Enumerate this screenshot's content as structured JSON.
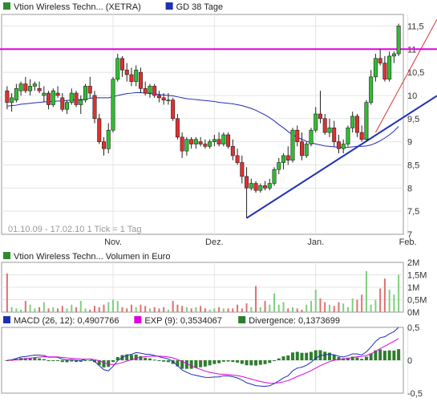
{
  "chart_data": [
    {
      "type": "candlestick",
      "legend": [
        {
          "label": "Vtion Wireless Techn... (XETRA)",
          "color": "#2e8b2e"
        },
        {
          "label": "GD 38 Tage",
          "color": "#1f2fb5"
        }
      ],
      "y_ticks": [
        "11,5",
        "11",
        "10,5",
        "10",
        "9,5",
        "9",
        "8,5",
        "8",
        "7,5",
        "7"
      ],
      "ylim": [
        7,
        11.75
      ],
      "x_ticks": [
        "Nov.",
        "Dez.",
        "Jan.",
        "Feb."
      ],
      "info_text": "01.10.09 - 17.02.10   1 Tick = 1 Tag",
      "horizontal_line": {
        "value": 11,
        "color": "#e000e0"
      },
      "candles": [
        [
          10.1,
          10.2,
          9.7,
          9.85
        ],
        [
          9.85,
          10.05,
          9.65,
          9.95
        ],
        [
          9.9,
          10.25,
          9.85,
          10.15
        ],
        [
          10.1,
          10.3,
          10.0,
          10.25
        ],
        [
          10.25,
          10.4,
          10.05,
          10.1
        ],
        [
          10.1,
          10.35,
          10.0,
          10.2
        ],
        [
          10.2,
          10.3,
          10.1,
          10.25
        ],
        [
          10.15,
          10.3,
          10.05,
          10.1
        ],
        [
          10.0,
          10.2,
          9.85,
          10.05
        ],
        [
          10.05,
          10.1,
          9.7,
          9.8
        ],
        [
          9.8,
          10.15,
          9.75,
          10.1
        ],
        [
          10.05,
          10.2,
          9.95,
          10.0
        ],
        [
          9.95,
          10.05,
          9.65,
          9.7
        ],
        [
          9.7,
          9.9,
          9.6,
          9.85
        ],
        [
          9.85,
          10.15,
          9.8,
          10.05
        ],
        [
          10.05,
          10.1,
          9.75,
          9.8
        ],
        [
          9.8,
          10.0,
          9.6,
          9.9
        ],
        [
          9.9,
          10.25,
          9.85,
          10.2
        ],
        [
          10.2,
          10.4,
          9.95,
          10.05
        ],
        [
          10.0,
          10.1,
          9.4,
          9.5
        ],
        [
          9.5,
          9.6,
          8.95,
          9.0
        ],
        [
          9.0,
          9.1,
          8.7,
          8.85
        ],
        [
          8.85,
          9.4,
          8.75,
          9.25
        ],
        [
          9.25,
          10.4,
          9.2,
          10.35
        ],
        [
          10.35,
          10.9,
          10.3,
          10.8
        ],
        [
          10.8,
          10.85,
          10.4,
          10.55
        ],
        [
          10.55,
          10.7,
          10.3,
          10.45
        ],
        [
          10.45,
          10.6,
          10.2,
          10.3
        ],
        [
          10.3,
          10.65,
          10.2,
          10.55
        ],
        [
          10.5,
          10.6,
          10.05,
          10.15
        ],
        [
          10.15,
          10.3,
          10.0,
          10.05
        ],
        [
          10.05,
          10.25,
          9.95,
          10.2
        ],
        [
          10.2,
          10.25,
          9.95,
          10.0
        ],
        [
          10.0,
          10.1,
          9.85,
          9.95
        ],
        [
          9.95,
          10.05,
          9.8,
          9.9
        ],
        [
          9.9,
          10.05,
          9.8,
          9.9
        ],
        [
          9.9,
          9.95,
          9.45,
          9.5
        ],
        [
          9.5,
          9.6,
          9.05,
          9.1
        ],
        [
          9.1,
          9.2,
          8.65,
          8.8
        ],
        [
          8.8,
          9.1,
          8.7,
          9.05
        ],
        [
          9.05,
          9.1,
          8.85,
          8.95
        ],
        [
          8.95,
          9.1,
          8.85,
          9.05
        ],
        [
          9.0,
          9.1,
          8.9,
          8.95
        ],
        [
          8.95,
          9.05,
          8.85,
          8.9
        ],
        [
          8.9,
          9.05,
          8.85,
          9.0
        ],
        [
          9.0,
          9.15,
          8.9,
          9.05
        ],
        [
          9.05,
          9.2,
          8.9,
          8.95
        ],
        [
          8.95,
          9.2,
          8.9,
          9.15
        ],
        [
          9.15,
          9.2,
          8.85,
          8.9
        ],
        [
          8.9,
          9.05,
          8.6,
          8.7
        ],
        [
          8.7,
          8.85,
          8.5,
          8.55
        ],
        [
          8.55,
          8.7,
          8.1,
          8.25
        ],
        [
          8.25,
          8.45,
          7.35,
          8.0
        ],
        [
          8.0,
          8.2,
          7.95,
          8.1
        ],
        [
          8.1,
          8.15,
          7.9,
          7.95
        ],
        [
          7.95,
          8.1,
          7.9,
          8.05
        ],
        [
          8.05,
          8.15,
          7.95,
          8.0
        ],
        [
          8.0,
          8.2,
          7.95,
          8.1
        ],
        [
          8.1,
          8.45,
          8.05,
          8.4
        ],
        [
          8.4,
          8.65,
          8.3,
          8.55
        ],
        [
          8.55,
          8.75,
          8.4,
          8.7
        ],
        [
          8.7,
          8.9,
          8.5,
          8.6
        ],
        [
          8.6,
          9.3,
          8.55,
          9.25
        ],
        [
          9.25,
          9.35,
          8.9,
          9.0
        ],
        [
          9.0,
          9.2,
          8.6,
          8.7
        ],
        [
          8.7,
          9.0,
          8.65,
          8.95
        ],
        [
          8.95,
          9.3,
          8.9,
          9.25
        ],
        [
          9.25,
          9.75,
          9.2,
          9.6
        ],
        [
          9.6,
          10.1,
          9.4,
          9.5
        ],
        [
          9.5,
          9.6,
          9.15,
          9.2
        ],
        [
          9.2,
          9.5,
          9.1,
          9.3
        ],
        [
          9.3,
          9.45,
          8.9,
          9.0
        ],
        [
          9.0,
          9.15,
          8.75,
          8.85
        ],
        [
          8.85,
          9.05,
          8.75,
          8.95
        ],
        [
          8.95,
          9.35,
          8.9,
          9.3
        ],
        [
          9.3,
          9.65,
          9.2,
          9.55
        ],
        [
          9.55,
          9.6,
          9.1,
          9.2
        ],
        [
          9.2,
          9.35,
          9.0,
          9.05
        ],
        [
          9.05,
          9.9,
          9.0,
          9.85
        ],
        [
          9.85,
          10.55,
          9.8,
          10.4
        ],
        [
          10.4,
          10.9,
          10.3,
          10.8
        ],
        [
          10.8,
          11.0,
          10.65,
          10.7
        ],
        [
          10.7,
          10.85,
          10.3,
          10.35
        ],
        [
          10.35,
          10.95,
          10.3,
          10.85
        ],
        [
          10.85,
          10.95,
          10.7,
          10.9
        ],
        [
          10.9,
          11.55,
          10.85,
          11.5
        ]
      ],
      "moving_average": [
        9.77,
        9.78,
        9.79,
        9.81,
        9.82,
        9.83,
        9.84,
        9.85,
        9.86,
        9.87,
        9.87,
        9.88,
        9.88,
        9.89,
        9.9,
        9.91,
        9.91,
        9.92,
        9.94,
        9.95,
        9.95,
        9.95,
        9.95,
        9.97,
        10.0,
        10.02,
        10.04,
        10.05,
        10.06,
        10.06,
        10.05,
        10.04,
        10.03,
        10.02,
        10.01,
        10.0,
        9.99,
        9.97,
        9.95,
        9.93,
        9.92,
        9.91,
        9.9,
        9.89,
        9.88,
        9.87,
        9.85,
        9.84,
        9.83,
        9.82,
        9.8,
        9.78,
        9.75,
        9.72,
        9.68,
        9.63,
        9.58,
        9.52,
        9.45,
        9.37,
        9.3,
        9.22,
        9.15,
        9.1,
        9.05,
        9.01,
        8.98,
        8.95,
        8.93,
        8.91,
        8.9,
        8.89,
        8.88,
        8.88,
        8.88,
        8.89,
        8.9,
        8.9,
        8.91,
        8.93,
        8.97,
        9.02,
        9.08,
        9.15,
        9.23,
        9.33
      ],
      "trendlines": [
        {
          "color": "#1f2fb5",
          "from": [
            52,
            7.35
          ],
          "to": [
            95,
            10.1
          ]
        },
        {
          "color": "#e03030",
          "from": [
            80,
            9.2
          ],
          "to": [
            95,
            11.95
          ]
        }
      ]
    },
    {
      "type": "bar",
      "legend": [
        {
          "label": "Vtion Wireless Techn... Volumen in Euro",
          "color": "#2e8b2e"
        }
      ],
      "y_ticks": [
        "2M",
        "1,5M",
        "1M",
        "0,5M",
        "0M"
      ],
      "ylim": [
        0,
        2
      ],
      "values": [
        1.55,
        0.2,
        0.15,
        0.1,
        0.45,
        0.3,
        0.15,
        0.2,
        0.4,
        0.15,
        0.2,
        0.15,
        0.25,
        0.15,
        0.3,
        0.2,
        0.45,
        0.15,
        0.1,
        0.25,
        0.2,
        0.3,
        0.4,
        0.5,
        0.45,
        0.2,
        0.15,
        0.3,
        0.2,
        0.3,
        0.25,
        0.15,
        0.2,
        0.15,
        0.2,
        0.1,
        0.45,
        0.3,
        0.25,
        0.2,
        0.15,
        0.2,
        0.25,
        0.15,
        0.1,
        0.15,
        0.2,
        0.15,
        0.15,
        0.15,
        0.3,
        0.15,
        0.35,
        0.2,
        1.05,
        0.2,
        0.45,
        0.3,
        0.75,
        0.3,
        0.4,
        0.15,
        0.2,
        0.15,
        0.1,
        0.3,
        0.45,
        0.9,
        0.55,
        0.4,
        0.3,
        0.25,
        0.4,
        0.35,
        0.2,
        0.55,
        0.5,
        0.7,
        1.65,
        0.3,
        0.5,
        0.95,
        1.35,
        0.9,
        0.7,
        1.5
      ]
    },
    {
      "type": "line",
      "legend": [
        {
          "label": "MACD (26, 12): 0,4907766",
          "color": "#1f2fb5"
        },
        {
          "label": "EXP (9): 0,3534067",
          "color": "#e000e0"
        },
        {
          "label": "Divergence: 0,1373699",
          "color": "#2e7d2e"
        }
      ],
      "y_ticks": [
        "0,5",
        "0",
        "-0,5"
      ],
      "ylim": [
        -0.5,
        0.5
      ]
    }
  ]
}
